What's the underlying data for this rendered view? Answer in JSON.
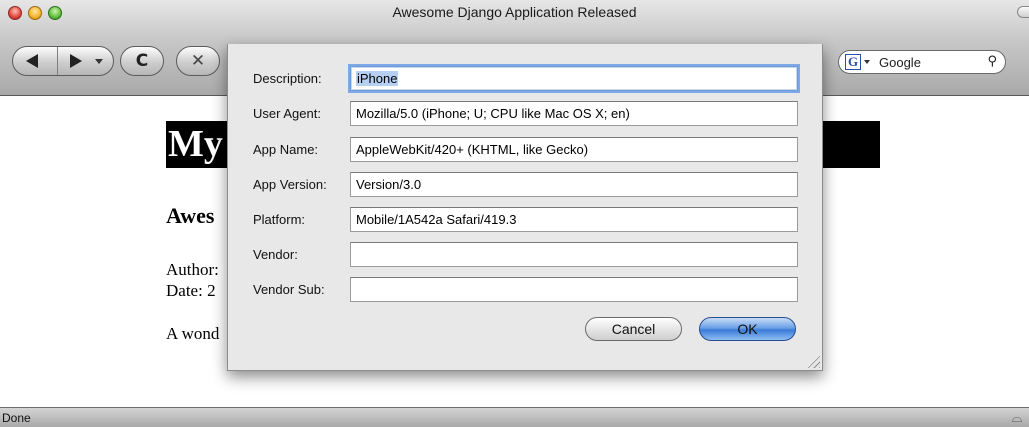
{
  "window": {
    "title": "Awesome Django Application Released"
  },
  "toolbar": {
    "reload_glyph": "C",
    "stop_glyph": "✕",
    "search": {
      "engine_badge": "G",
      "placeholder": "Google",
      "icon": "magnifier-icon"
    }
  },
  "page": {
    "banner_visible": "My",
    "heading_visible": "Awes",
    "meta_line1_visible": "Author:",
    "meta_line2_visible": "Date: 2",
    "body_visible": "A wond"
  },
  "status": {
    "text": "Done"
  },
  "dialog": {
    "fields": [
      {
        "label": "Description:",
        "value": "iPhone"
      },
      {
        "label": "User Agent:",
        "value": "Mozilla/5.0 (iPhone; U; CPU like Mac OS X; en)"
      },
      {
        "label": "App Name:",
        "value": "AppleWebKit/420+ (KHTML, like Gecko)"
      },
      {
        "label": "App Version:",
        "value": "Version/3.0"
      },
      {
        "label": "Platform:",
        "value": "Mobile/1A542a Safari/419.3"
      },
      {
        "label": "Vendor:",
        "value": ""
      },
      {
        "label": "Vendor Sub:",
        "value": ""
      }
    ],
    "cancel_label": "Cancel",
    "ok_label": "OK"
  }
}
